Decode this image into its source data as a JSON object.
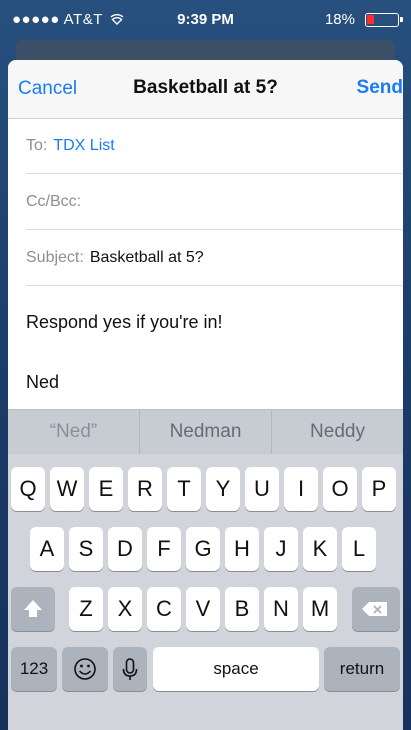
{
  "status_bar": {
    "carrier": "●●●●● AT&T",
    "time": "9:39 PM",
    "battery": "18%",
    "battery_level": 0.18,
    "colors": {
      "battery_low": "#ff2d2d"
    }
  },
  "nav": {
    "cancel": "Cancel",
    "title": "Basketball at 5?",
    "send": "Send",
    "accent": "#1a7cf5"
  },
  "fields": {
    "to_label": "To:",
    "to_value": "TDX List",
    "ccbcc_label": "Cc/Bcc:",
    "subject_label": "Subject:",
    "subject_value": "Basketball at 5?"
  },
  "body": {
    "line1": "Respond yes if you're in!",
    "line2": "Ned"
  },
  "predictions": [
    "“Ned”",
    "Nedman",
    "Neddy"
  ],
  "keyboard": {
    "row1": [
      "Q",
      "W",
      "E",
      "R",
      "T",
      "Y",
      "U",
      "I",
      "O",
      "P"
    ],
    "row2": [
      "A",
      "S",
      "D",
      "F",
      "G",
      "H",
      "J",
      "K",
      "L"
    ],
    "row3": [
      "Z",
      "X",
      "C",
      "V",
      "B",
      "N",
      "M"
    ],
    "numbers": "123",
    "space": "space",
    "return": "return",
    "icons": {
      "shift": "shift-icon",
      "delete": "delete-icon",
      "emoji": "emoji-icon",
      "mic": "microphone-icon",
      "wifi": "wifi-icon"
    }
  }
}
